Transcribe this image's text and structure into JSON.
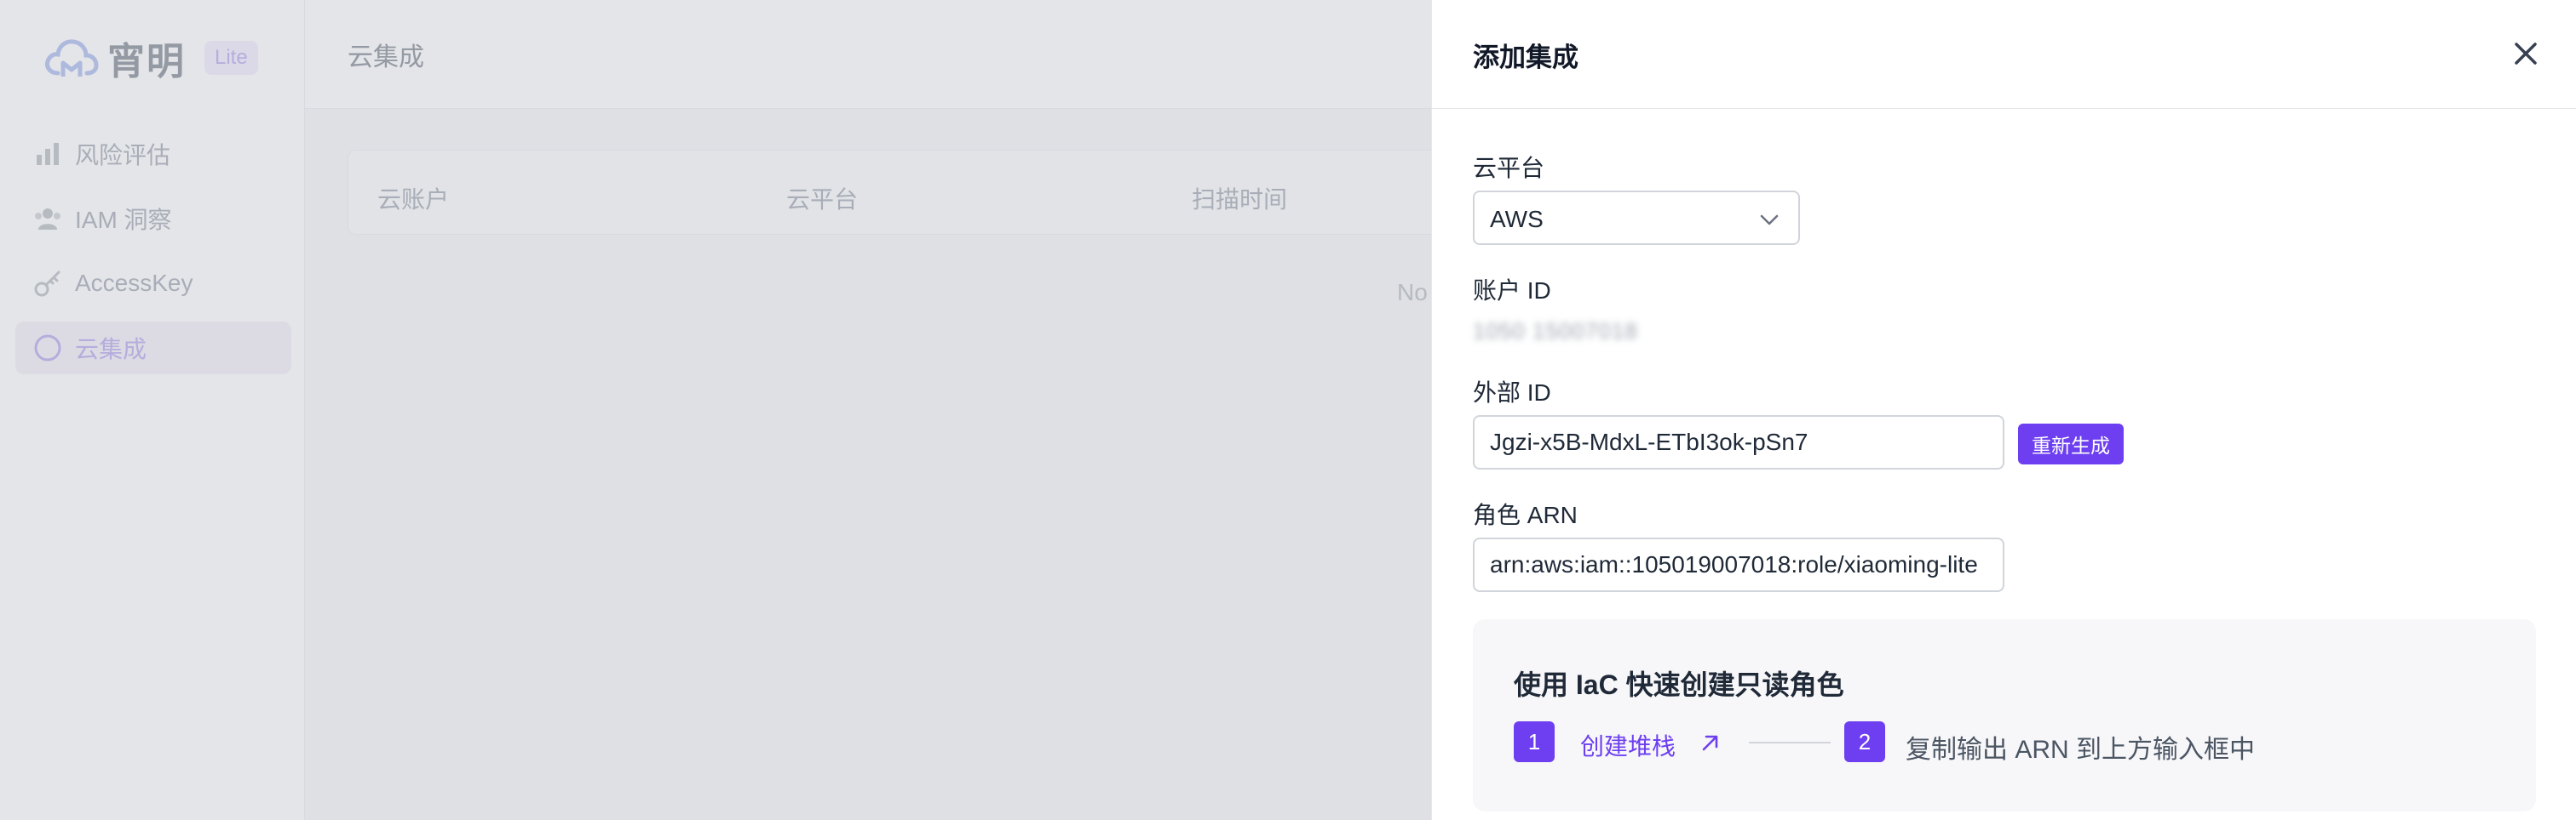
{
  "app": {
    "logo_text": "宵明",
    "logo_badge": "Lite"
  },
  "sidebar": {
    "items": [
      {
        "label": "风险评估",
        "icon": "bar-chart-icon",
        "active": false
      },
      {
        "label": "IAM 洞察",
        "icon": "users-icon",
        "active": false
      },
      {
        "label": "AccessKey",
        "icon": "key-icon",
        "active": false
      },
      {
        "label": "云集成",
        "icon": "cloud-ring-icon",
        "active": true
      }
    ]
  },
  "page": {
    "title": "云集成",
    "table_headers": [
      "云账户",
      "云平台",
      "扫描时间"
    ],
    "empty_text": "No"
  },
  "drawer": {
    "title": "添加集成",
    "cloud_platform": {
      "label": "云平台",
      "value": "AWS"
    },
    "account_id": {
      "label": "账户 ID",
      "value": "1050 15007018"
    },
    "external_id": {
      "label": "外部 ID",
      "value": "Jgzi-x5B-MdxL-ETbI3ok-pSn7",
      "regenerate_label": "重新生成"
    },
    "role_arn": {
      "label": "角色 ARN",
      "value": "arn:aws:iam::105019007018:role/xiaoming-lite"
    },
    "iac": {
      "title": "使用 IaC 快速创建只读角色",
      "steps": [
        {
          "num": "1",
          "label": "创建堆栈"
        },
        {
          "num": "2",
          "label": "复制输出 ARN 到上方输入框中"
        }
      ]
    }
  },
  "colors": {
    "accent": "#6d3ff0",
    "border": "#d1d5db"
  }
}
